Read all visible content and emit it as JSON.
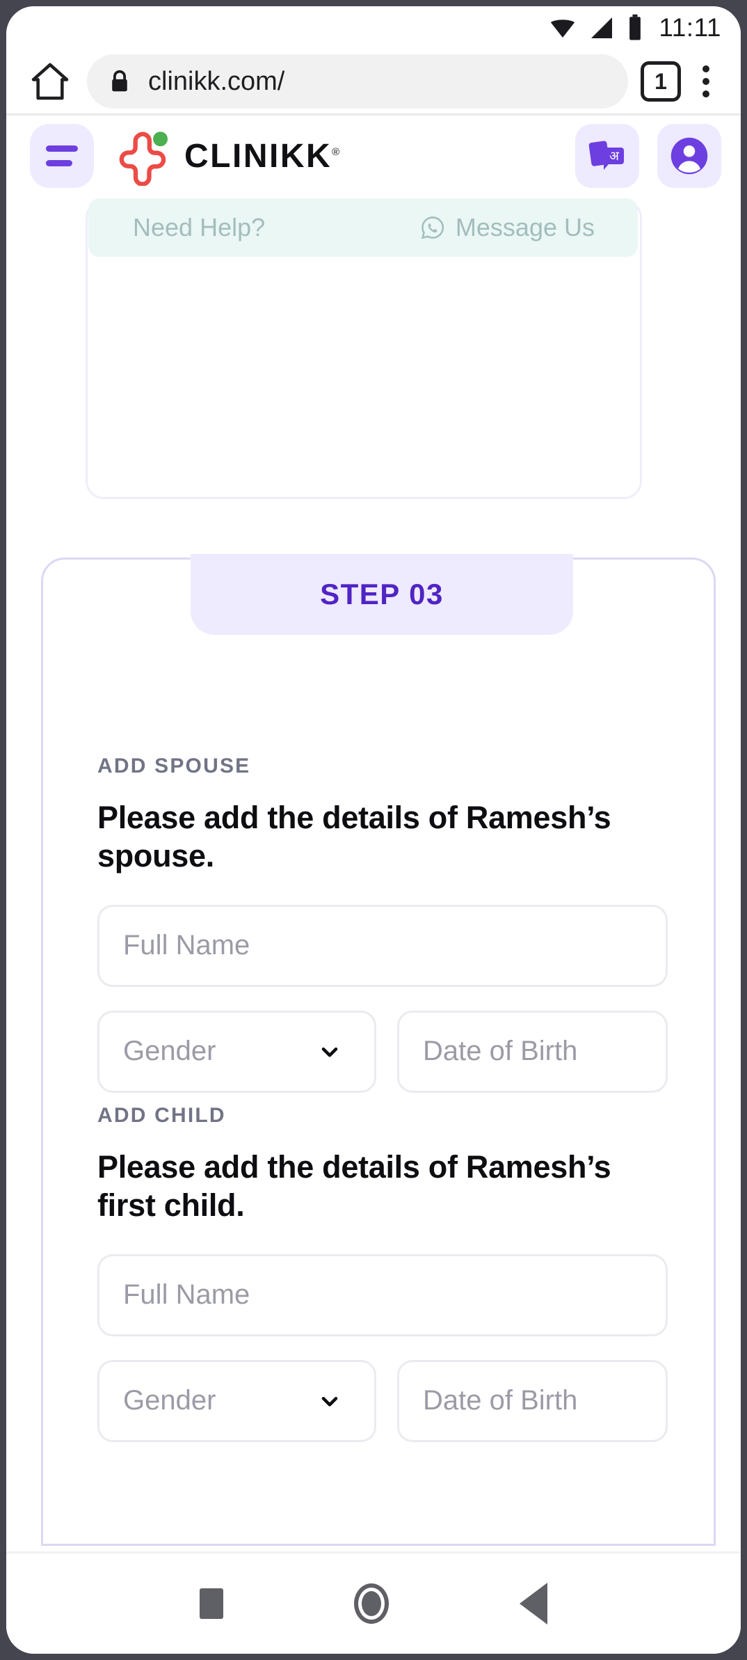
{
  "status_bar": {
    "time": "11:11",
    "icons": [
      "wifi-icon",
      "cellular-signal-icon",
      "battery-icon"
    ]
  },
  "browser": {
    "home_icon": "home-icon",
    "lock_icon": "lock-icon",
    "url": "clinikk.com/",
    "tab_count": "1",
    "menu_icon": "overflow-menu-icon"
  },
  "site_header": {
    "menu_icon": "hamburger-menu-icon",
    "brand_name": "CLINIKK",
    "brand_trademark": "®",
    "logo_icon": "clinikk-logo-icon",
    "language_icon": "language-translate-icon",
    "account_icon": "user-account-icon"
  },
  "help_strip": {
    "need_help_label": "Need Help?",
    "message_us_label": "Message Us",
    "whatsapp_icon": "whatsapp-icon"
  },
  "step_card": {
    "tab_label": "STEP 03",
    "spouse": {
      "kicker": "ADD SPOUSE",
      "heading": "Please add the details of Ramesh’s spouse.",
      "full_name_placeholder": "Full Name",
      "gender_placeholder": "Gender",
      "gender_chevron_icon": "chevron-down-icon",
      "dob_placeholder": "Date of Birth"
    },
    "child": {
      "kicker": "ADD CHILD",
      "heading": "Please add the details of Ramesh’s first child.",
      "full_name_placeholder": "Full Name",
      "gender_placeholder": "Gender",
      "gender_chevron_icon": "chevron-down-icon",
      "dob_placeholder": "Date of Birth"
    }
  },
  "nav_bar": {
    "recents_icon": "square-recents-icon",
    "home_icon": "circle-home-icon",
    "back_icon": "triangle-back-icon"
  },
  "colors": {
    "accent_purple": "#5024c4",
    "tab_purple": "#eeeaff",
    "card_border": "#ddd7f5",
    "logo_red": "#ec4b46",
    "logo_green": "#4caf50",
    "mint": "#eaf7f5"
  }
}
